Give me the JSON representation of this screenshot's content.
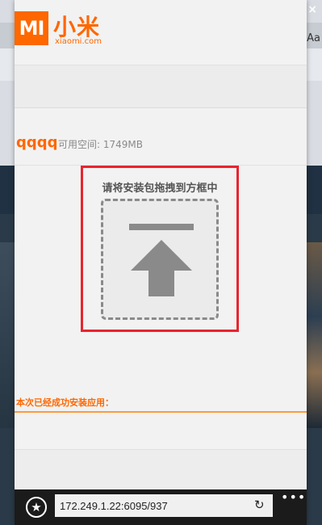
{
  "logo": {
    "mark": "MI",
    "name_cn": "小米",
    "domain": "xiaomi.com"
  },
  "device": {
    "name": "qqqq",
    "free_space_label": "可用空间:",
    "free_space_value": "1749MB"
  },
  "drop_zone": {
    "title": "请将安装包拖拽到方框中",
    "icon": "upload-arrow-icon"
  },
  "installed_label": "本次已经成功安装应用：",
  "browser": {
    "url": "172.249.1.22:6095/937",
    "star_icon": "star-icon",
    "refresh_icon": "refresh-icon",
    "more_icon": "more-icon",
    "more_label": "•••"
  },
  "background": {
    "aa_text": "Aa",
    "close_label": "×"
  },
  "colors": {
    "brand": "#ff6700",
    "highlight": "#e8242f"
  }
}
